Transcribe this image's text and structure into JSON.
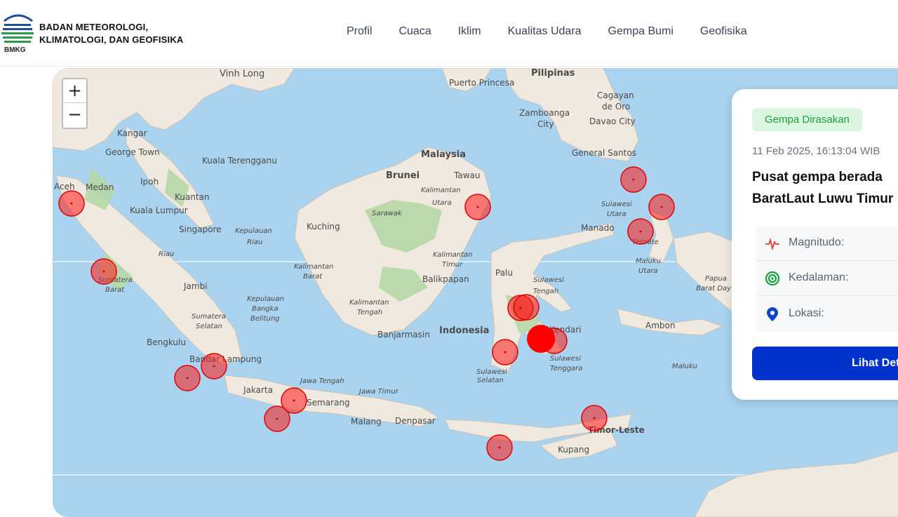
{
  "header": {
    "org_line1": "BADAN METEOROLOGI,",
    "org_line2": "KLIMATOLOGI, DAN GEOFISIKA",
    "logo_text": "BMKG",
    "nav": [
      "Profil",
      "Cuaca",
      "Iklim",
      "Kualitas Udara",
      "Gempa Bumi",
      "Geofisika"
    ]
  },
  "map": {
    "zoom_in": "+",
    "zoom_out": "−",
    "labels": {
      "vinh_long": "Vinh Long",
      "pilipinas": "Pilipinas",
      "puerto_princesa": "Puerto Princesa",
      "cagayan": "Cagayan",
      "de_oro": "de Oro",
      "davao": "Davao City",
      "zamboanga": "Zamboanga",
      "city": "City",
      "kangar": "Kangar",
      "george_town": "George Town",
      "kuala_terengganu": "Kuala Terengganu",
      "malaysia": "Malaysia",
      "brunei": "Brunei",
      "tawau": "Tawau",
      "general_santos": "General Santos",
      "aceh": "Aceh",
      "medan": "Medan",
      "ipoh": "Ipoh",
      "kuantan": "Kuantan",
      "kalimantan_utara1": "Kalimantan",
      "kalimantan_utara2": "Utara",
      "sulawesi_utara1": "Sulawesi",
      "sulawesi_utara2": "Utara",
      "kuala_lumpur": "Kuala Lumpur",
      "sarawak": "Sarawak",
      "singapore": "Singapore",
      "kepulauan_riau1": "Kepulauan",
      "kepulauan_riau2": "Riau",
      "kuching": "Kuching",
      "manado": "Manado",
      "ternate": "Ternate",
      "riau": "Riau",
      "kalimantan_timur1": "Kalimantan",
      "kalimantan_timur2": "Timur",
      "palu": "Palu",
      "maluku_utara1": "Maluku",
      "maluku_utara2": "Utara",
      "sumatera_barat1": "Sumatera",
      "sumatera_barat2": "Barat",
      "kalimantan_barat1": "Kalimantan",
      "kalimantan_barat2": "Barat",
      "balikpapan": "Balikpapan",
      "sulawesi_tengah1": "Sulawesi",
      "sulawesi_tengah2": "Tengah",
      "papua1": "Papua",
      "papua2": "Barat Day",
      "jambi": "Jambi",
      "kep_bangka1": "Kepulauan",
      "kep_bangka2": "Bangka",
      "kep_bangka3": "Belitung",
      "kalimantan_tengah1": "Kalimantan",
      "kalimantan_tengah2": "Tengah",
      "sumatera_selatan1": "Sumatera",
      "sumatera_selatan2": "Selatan",
      "indonesia": "Indonesia",
      "banjarmasin": "Banjarmasin",
      "kendari": "Kendari",
      "ambon": "Ambon",
      "bengkulu": "Bengkulu",
      "bandar_lampung": "Bandar Lampung",
      "sulawesi_selatan1": "Sulawesi",
      "sulawesi_selatan2": "Selatan",
      "sulawesi_tenggara1": "Sulawesi",
      "sulawesi_tenggara2": "Tenggara",
      "maluku": "Maluku",
      "jakarta": "Jakarta",
      "jawa_tengah": "Jawa Tengah",
      "jawa_timur": "Jawa Timur",
      "semarang": "Semarang",
      "malang": "Malang",
      "denpasar": "Denpasar",
      "timor_leste": "Timor-Leste",
      "kupang": "Kupang"
    }
  },
  "card": {
    "badge": "Gempa Dirasakan",
    "date": "11 Feb 2025, 16:13:04 WIB",
    "title_line1": "Pusat gempa berada",
    "title_line2": "BaratLaut Luwu Timur",
    "magnitude_label": "Magnitudo:",
    "depth_label": "Kedalaman:",
    "location_label": "Lokasi:",
    "detail_button": "Lihat Detail"
  },
  "colors": {
    "accent_blue": "#0033cc",
    "badge_green": "#18a23a",
    "quake_red": "#ff1a1a",
    "sea": "#a9d3ef",
    "land": "#efe9df"
  }
}
